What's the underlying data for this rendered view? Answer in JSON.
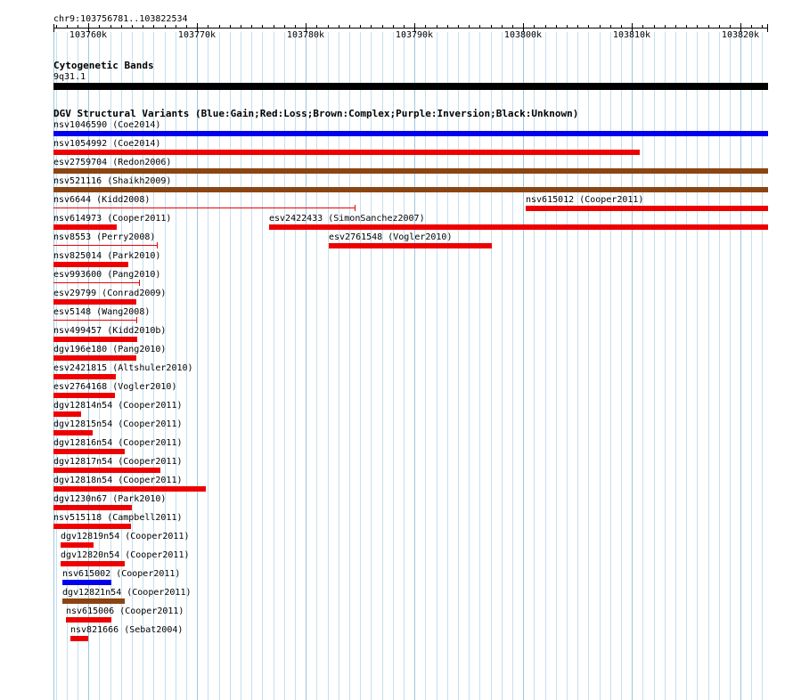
{
  "ruler": {
    "locus": "chr9:103756781..103822534",
    "start": 103756781,
    "end": 103822534,
    "tick_labels": [
      "103760k",
      "103770k",
      "103780k",
      "103790k",
      "103800k",
      "103810k",
      "103820k"
    ],
    "tick_values": [
      103760000,
      103770000,
      103780000,
      103790000,
      103800000,
      103810000,
      103820000
    ]
  },
  "cytoband": {
    "title": "Cytogenetic Bands",
    "band_label": "9q31.1",
    "color": "#000000"
  },
  "dgv": {
    "title": "DGV Structural Variants (Blue:Gain;Red:Loss;Brown:Complex;Purple:Inversion;Black:Unknown)",
    "colors": {
      "gain": "#0000ee",
      "loss": "#ee0000",
      "complex": "#8b4513",
      "inversion": "#800080",
      "unknown": "#000000"
    },
    "features": [
      {
        "label": "nsv1046590 (Coe2014)",
        "type": "gain",
        "start": 103756781,
        "end": 103822534,
        "style": "bar"
      },
      {
        "label": "nsv1054992 (Coe2014)",
        "type": "loss",
        "start": 103756781,
        "end": 103810700,
        "style": "bar"
      },
      {
        "label": "esv2759704 (Redon2006)",
        "type": "complex",
        "start": 103756781,
        "end": 103822534,
        "style": "bar"
      },
      {
        "label": "nsv521116 (Shaikh2009)",
        "type": "complex",
        "start": 103756781,
        "end": 103822534,
        "style": "bar"
      },
      {
        "label": "nsv6644 (Kidd2008)",
        "type": "loss",
        "start": 103756781,
        "end": 103784600,
        "style": "thin"
      },
      {
        "label": "nsv615012 (Cooper2011)",
        "type": "loss",
        "start": 103800200,
        "end": 103822534,
        "style": "bar"
      },
      {
        "label": "nsv614973 (Cooper2011)",
        "type": "loss",
        "start": 103756781,
        "end": 103762600,
        "style": "bar"
      },
      {
        "label": "esv2422433 (SimonSanchez2007)",
        "type": "loss",
        "start": 103776600,
        "end": 103822534,
        "style": "bar"
      },
      {
        "label": "nsv8553 (Perry2008)",
        "type": "loss",
        "start": 103756781,
        "end": 103766400,
        "style": "thin"
      },
      {
        "label": "esv2761548 (Vogler2010)",
        "type": "loss",
        "start": 103782100,
        "end": 103797100,
        "style": "bar"
      },
      {
        "label": "nsv825014 (Park2010)",
        "type": "loss",
        "start": 103756781,
        "end": 103763700,
        "style": "bar"
      },
      {
        "label": "esv993600 (Pang2010)",
        "type": "loss",
        "start": 103756781,
        "end": 103764700,
        "style": "thin"
      },
      {
        "label": "esv29799 (Conrad2009)",
        "type": "loss",
        "start": 103756781,
        "end": 103764400,
        "style": "bar"
      },
      {
        "label": "esv5148 (Wang2008)",
        "type": "loss",
        "start": 103756781,
        "end": 103764500,
        "style": "thin"
      },
      {
        "label": "nsv499457 (Kidd2010b)",
        "type": "loss",
        "start": 103756781,
        "end": 103764500,
        "style": "bar"
      },
      {
        "label": "dgv196e180 (Pang2010)",
        "type": "loss",
        "start": 103756781,
        "end": 103764400,
        "style": "bar"
      },
      {
        "label": "esv2421815 (Altshuler2010)",
        "type": "loss",
        "start": 103756781,
        "end": 103762500,
        "style": "bar"
      },
      {
        "label": "esv2764168 (Vogler2010)",
        "type": "loss",
        "start": 103756781,
        "end": 103762400,
        "style": "bar"
      },
      {
        "label": "dgv12814n54 (Cooper2011)",
        "type": "loss",
        "start": 103756781,
        "end": 103759300,
        "style": "bar"
      },
      {
        "label": "dgv12815n54 (Cooper2011)",
        "type": "loss",
        "start": 103756781,
        "end": 103760400,
        "style": "bar"
      },
      {
        "label": "dgv12816n54 (Cooper2011)",
        "type": "loss",
        "start": 103756781,
        "end": 103763300,
        "style": "bar"
      },
      {
        "label": "dgv12817n54 (Cooper2011)",
        "type": "loss",
        "start": 103756781,
        "end": 103766600,
        "style": "bar"
      },
      {
        "label": "dgv12818n54 (Cooper2011)",
        "type": "loss",
        "start": 103756781,
        "end": 103770800,
        "style": "bar"
      },
      {
        "label": "dgv1230n67 (Park2010)",
        "type": "loss",
        "start": 103756781,
        "end": 103764000,
        "style": "bar"
      },
      {
        "label": "nsv515118 (Campbell2011)",
        "type": "loss",
        "start": 103756781,
        "end": 103763900,
        "style": "bar"
      },
      {
        "label": "dgv12819n54 (Cooper2011)",
        "type": "loss",
        "start": 103757400,
        "end": 103760500,
        "style": "bar"
      },
      {
        "label": "dgv12820n54 (Cooper2011)",
        "type": "loss",
        "start": 103757400,
        "end": 103763300,
        "style": "bar"
      },
      {
        "label": "nsv615002 (Cooper2011)",
        "type": "gain",
        "start": 103757600,
        "end": 103762100,
        "style": "bar"
      },
      {
        "label": "dgv12821n54 (Cooper2011)",
        "type": "complex",
        "start": 103757600,
        "end": 103763300,
        "style": "bar"
      },
      {
        "label": "nsv615006 (Cooper2011)",
        "type": "loss",
        "start": 103757900,
        "end": 103762100,
        "style": "bar"
      },
      {
        "label": "nsv821666 (Sebat2004)",
        "type": "loss",
        "start": 103758300,
        "end": 103760000,
        "style": "bar"
      }
    ]
  }
}
